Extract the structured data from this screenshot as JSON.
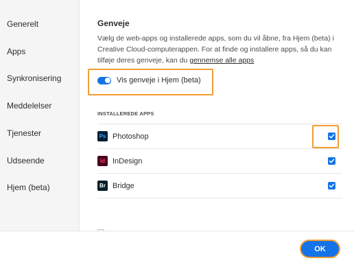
{
  "sidebar": {
    "items": [
      {
        "label": "Generelt"
      },
      {
        "label": "Apps"
      },
      {
        "label": "Synkronisering"
      },
      {
        "label": "Meddelelser"
      },
      {
        "label": "Tjenester"
      },
      {
        "label": "Udseende"
      },
      {
        "label": "Hjem (beta)"
      }
    ]
  },
  "section": {
    "title": "Genveje",
    "description_text": "Vælg de web-apps og installerede apps, som du vil åbne, fra Hjem (beta) i Creative Cloud-computerappen. For at finde og installere apps, så du kan tilføje deres genveje, kan du ",
    "description_link": "gennemse alle apps"
  },
  "toggle": {
    "label": "Vis genveje i Hjem (beta)",
    "on": true
  },
  "apps": {
    "header": "INSTALLEREDE APPS",
    "items": [
      {
        "icon_text": "Ps",
        "name": "Photoshop",
        "checked": true,
        "icon_bg": "#001e36",
        "icon_fg": "#31a8ff"
      },
      {
        "icon_text": "Id",
        "name": "InDesign",
        "checked": true,
        "icon_bg": "#49021f",
        "icon_fg": "#ff3366"
      },
      {
        "icon_text": "Br",
        "name": "Bridge",
        "checked": true,
        "icon_bg": "#001d26",
        "icon_fg": "#ffffff"
      }
    ]
  },
  "footer": {
    "ok_label": "OK"
  },
  "colors": {
    "accent": "#1473e6",
    "highlight": "#f39c34"
  }
}
